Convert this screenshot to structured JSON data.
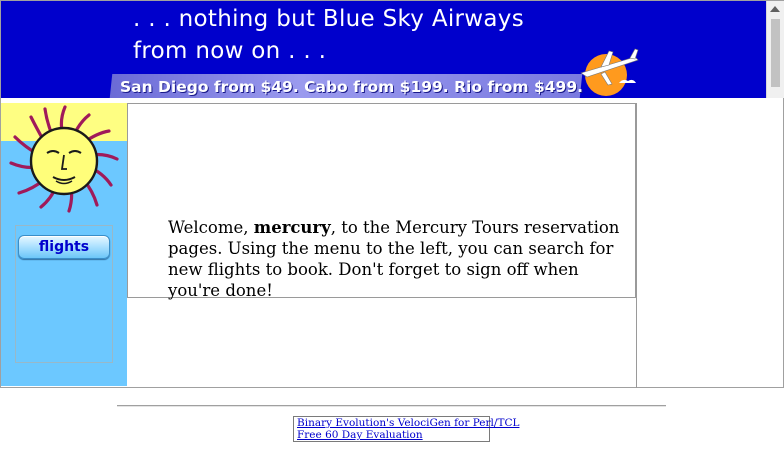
{
  "banner": {
    "slogan_line1": ". . . nothing but Blue Sky Airways",
    "slogan_line2": "from now on . . .",
    "promo": "San Diego from $49. Cabo from $199. Rio from $499.",
    "background_color": "#0000cc"
  },
  "sidebar": {
    "logo_icon": "sun-face-icon",
    "background_color": "#6cc8ff",
    "menu": [
      {
        "label": "flights"
      }
    ]
  },
  "main": {
    "welcome_prefix": "Welcome, ",
    "username": "mercury",
    "welcome_suffix": ", to the Mercury Tours reservation pages. Using the menu to the left, you can search for new flights to book. Don't forget to sign off when you're done!"
  },
  "footer": {
    "links": [
      {
        "label": "Binary Evolution's VelociGen for Perl/TCL"
      },
      {
        "label": "Free 60 Day Evaluation"
      }
    ]
  }
}
